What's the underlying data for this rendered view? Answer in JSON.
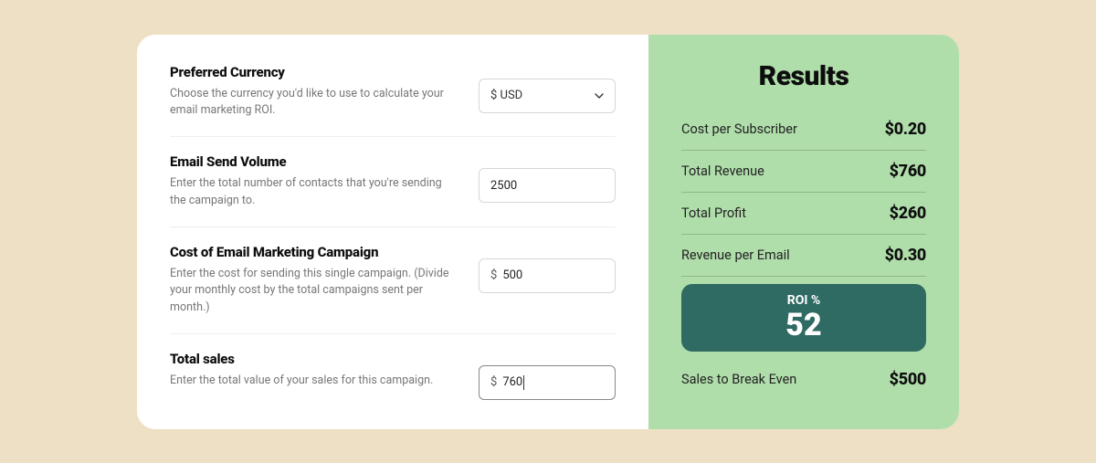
{
  "form": {
    "currency": {
      "label": "Preferred Currency",
      "desc": "Choose the currency you'd like to use to calculate your email marketing ROI.",
      "selected": "$ USD"
    },
    "volume": {
      "label": "Email Send Volume",
      "desc": "Enter the total number of contacts that you're sending the campaign to.",
      "value": "2500"
    },
    "cost": {
      "label": "Cost of Email Marketing Campaign",
      "desc": "Enter the cost for sending this single campaign. (Divide your monthly cost by the total campaigns sent per month.)",
      "prefix": "$",
      "value": "500"
    },
    "sales": {
      "label": "Total sales",
      "desc": "Enter the total value of your sales for this campaign.",
      "prefix": "$",
      "value": "760"
    }
  },
  "results": {
    "title": "Results",
    "rows": [
      {
        "label": "Cost per Subscriber",
        "value": "$0.20"
      },
      {
        "label": "Total Revenue",
        "value": "$760"
      },
      {
        "label": "Total Profit",
        "value": "$260"
      },
      {
        "label": "Revenue per Email",
        "value": "$0.30"
      }
    ],
    "roi": {
      "label": "ROI %",
      "value": "52"
    },
    "break_even": {
      "label": "Sales to Break Even",
      "value": "$500"
    }
  }
}
